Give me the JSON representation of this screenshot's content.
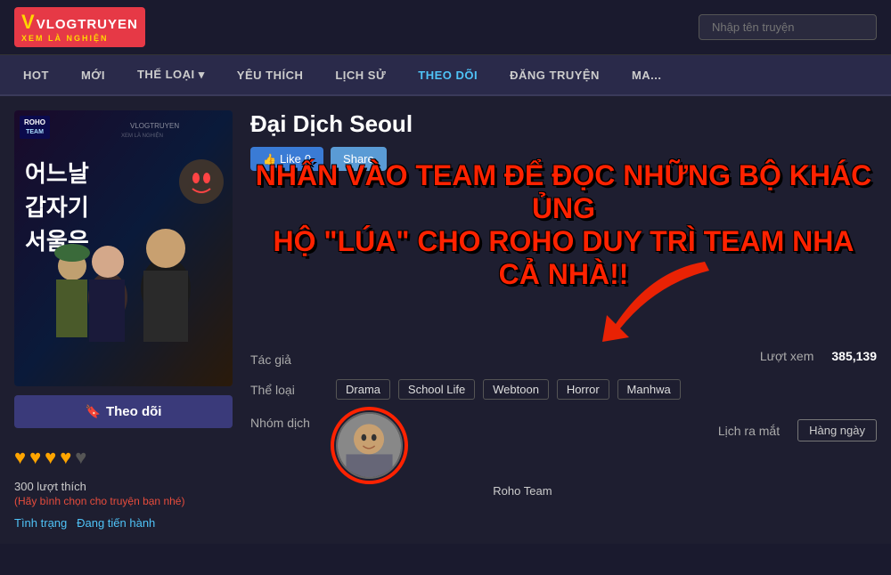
{
  "site": {
    "logo_main": "VLOGTRUYEN",
    "logo_sub": "XEM LÀ NGHIỆN",
    "search_placeholder": "Nhập tên truyện"
  },
  "nav": {
    "items": [
      {
        "label": "HOT",
        "id": "hot"
      },
      {
        "label": "MỚI",
        "id": "moi"
      },
      {
        "label": "THỂ LOẠI ▾",
        "id": "the-loai"
      },
      {
        "label": "YÊU THÍCH",
        "id": "yeu-thich"
      },
      {
        "label": "LỊCH SỬ",
        "id": "lich-su"
      },
      {
        "label": "THEO DÕI",
        "id": "theo-doi"
      },
      {
        "label": "ĐĂNG TRUYỆN",
        "id": "dang-truyen"
      },
      {
        "label": "MA...",
        "id": "ma"
      }
    ]
  },
  "manga": {
    "title": "Đại Dịch Seoul",
    "cover_title": "어느날 갑자기 서울은",
    "like_count": "0",
    "like_label": "Like",
    "share_label": "Share",
    "tac_gia_label": "Tác giả",
    "tac_gia_value": "",
    "the_loai_label": "Thể loại",
    "tags": [
      "Drama",
      "School Life",
      "Webtoon",
      "Horror",
      "Manhwa"
    ],
    "nhom_dich_label": "Nhóm dịch",
    "team_name": "Roho Team",
    "luot_xem_label": "Lượt xem",
    "luot_xem_value": "385,139",
    "lich_ra_mat_label": "Lịch ra mắt",
    "lich_ra_mat_value": "Hàng ngày",
    "theo_doi_btn": "Theo dõi",
    "stars_count": 4,
    "votes": "300 lượt thích",
    "vote_cta": "(Hãy bình chọn cho truyện bạn nhé)",
    "tinh_trang_label": "Tình trạng",
    "tinh_trang_value": "Đang tiến hành"
  },
  "promo": {
    "line1": "NHẤN VÀO TEAM ĐỂ ĐỌC NHỮNG BỘ KHÁC ỦNG",
    "line2": "HỘ \"LÚA\" CHO ROHO DUY TRÌ TEAM NHA CẢ NHÀ!!"
  },
  "colors": {
    "accent": "#4fc3f7",
    "danger": "#e74c3c",
    "promo": "#ff2200",
    "nav_bg": "#2a2a4a",
    "body_bg": "#1a1a2e"
  }
}
